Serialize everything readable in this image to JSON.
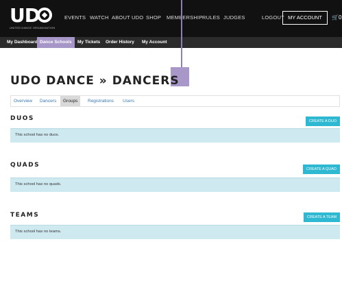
{
  "logo": {
    "text": "UD",
    "subtitle": "UNITED DANCE ORGANISATION"
  },
  "nav": {
    "items": [
      "EVENTS",
      "WATCH",
      "ABOUT UDO",
      "SHOP",
      "MEMBERSHIP",
      "RULES",
      "JUDGES"
    ],
    "logout": "LOGOUT",
    "account": "MY ACCOUNT",
    "cart_count": "0"
  },
  "subnav": {
    "items": [
      "My Dashboard",
      "Dance Schools",
      "My Tickets",
      "Order History",
      "My Account"
    ],
    "active": "Dance Schools"
  },
  "page": {
    "title": "UDO DANCE » DANCERS"
  },
  "tabs": {
    "items": [
      "Overview",
      "Dancers",
      "Groups",
      "Registrations",
      "Users"
    ],
    "active": "Groups"
  },
  "sections": {
    "duos": {
      "title": "DUOS",
      "button": "CREATE A DUO",
      "message": "This school has no duos."
    },
    "quads": {
      "title": "QUADS",
      "button": "CREATE A QUAD",
      "message": "This school has no quads."
    },
    "teams": {
      "title": "TEAMS",
      "button": "CREATE A TEAM",
      "message": "This school has no teams."
    }
  },
  "colors": {
    "topbar": "#111111",
    "subnav": "#2b2b2b",
    "accent_purple": "#a695c7",
    "button_cyan": "#2eb8d2",
    "info_bg": "#cfe9f1",
    "link_blue": "#3a78b5"
  }
}
